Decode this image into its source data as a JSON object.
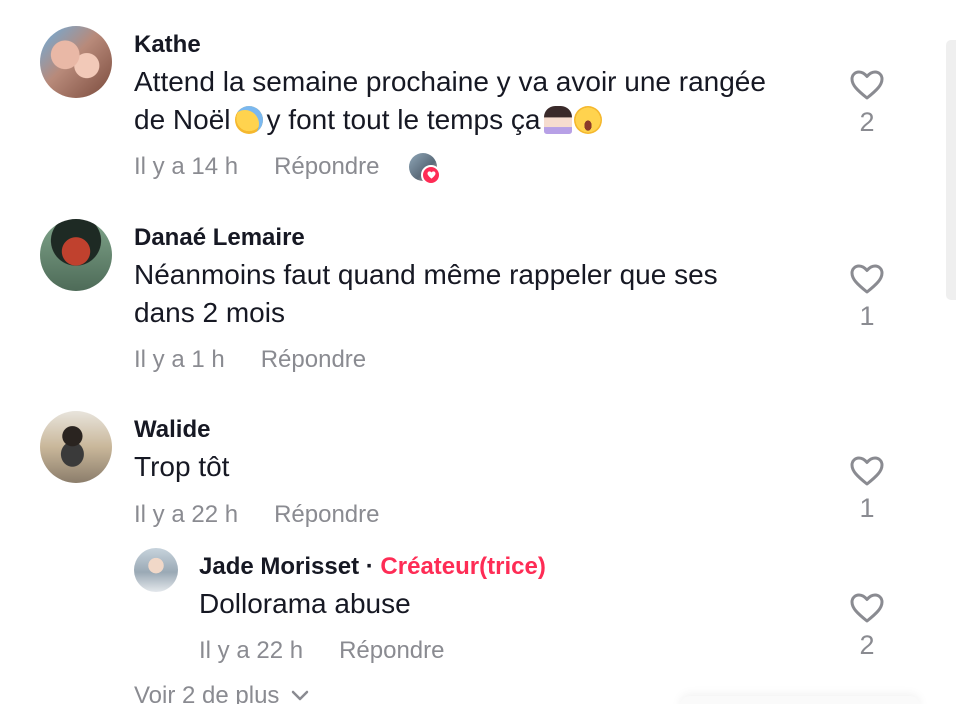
{
  "comments": [
    {
      "username": "Kathe",
      "line1": "Attend la semaine prochaine y va avoir une rangée",
      "line2_before": "de Noël",
      "line2_after": "y font tout le temps ça",
      "emojis": [
        "sweat-emoji",
        "facepalm-emoji",
        "laugh-cry-emoji"
      ],
      "time": "Il y a 14 h",
      "reply_label": "Répondre",
      "likes": "2",
      "liked_by_creator": true
    },
    {
      "username": "Danaé Lemaire",
      "line1": "Néanmoins faut quand même rappeler que ses",
      "line2": "dans 2 mois",
      "time": "Il y a 1 h",
      "reply_label": "Répondre",
      "likes": "1"
    },
    {
      "username": "Walide",
      "line1": "Trop tôt",
      "time": "Il y a 22 h",
      "reply_label": "Répondre",
      "likes": "1"
    }
  ],
  "reply": {
    "username": "Jade Morisset",
    "separator": "·",
    "creator_label": "Créateur(trice)",
    "text": "Dollorama abuse",
    "time": "Il y a 22 h",
    "reply_label": "Répondre",
    "likes": "2"
  },
  "view_more": "Voir 2 de plus",
  "colors": {
    "text": "#161823",
    "muted": "#8a8b91",
    "creator_accent": "#fe2c55"
  },
  "icons": [
    "heart-outline-icon",
    "chevron-down-icon",
    "heart-badge-icon"
  ]
}
